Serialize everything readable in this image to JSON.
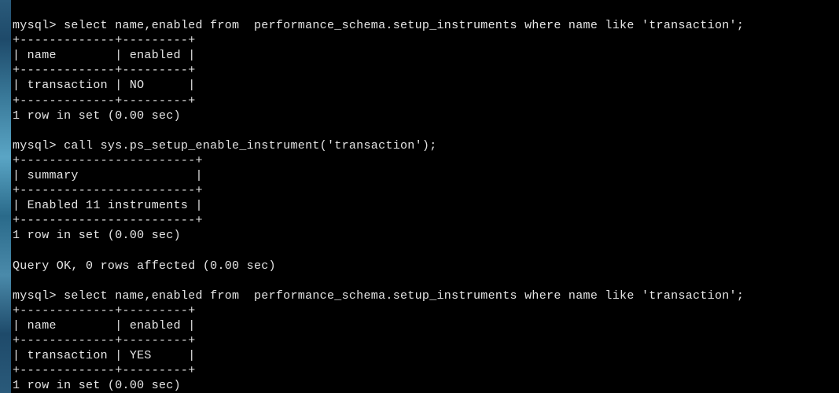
{
  "terminal": {
    "prompt": "mysql> ",
    "query1": "select name,enabled from  performance_schema.setup_instruments where name like 'transaction';",
    "result1": {
      "border_top": "+-------------+---------+",
      "header": "| name        | enabled |",
      "border_mid": "+-------------+---------+",
      "row": "| transaction | NO      |",
      "border_bottom": "+-------------+---------+",
      "status": "1 row in set (0.00 sec)"
    },
    "blank1": "",
    "query2": "call sys.ps_setup_enable_instrument('transaction');",
    "result2": {
      "border_top": "+------------------------+",
      "header": "| summary                |",
      "border_mid": "+------------------------+",
      "row": "| Enabled 11 instruments |",
      "border_bottom": "+------------------------+",
      "status": "1 row in set (0.00 sec)"
    },
    "blank2": "",
    "query_ok": "Query OK, 0 rows affected (0.00 sec)",
    "blank3": "",
    "query3": "select name,enabled from  performance_schema.setup_instruments where name like 'transaction';",
    "result3": {
      "border_top": "+-------------+---------+",
      "header": "| name        | enabled |",
      "border_mid": "+-------------+---------+",
      "row": "| transaction | YES     |",
      "border_bottom": "+-------------+---------+",
      "status": "1 row in set (0.00 sec)"
    }
  }
}
